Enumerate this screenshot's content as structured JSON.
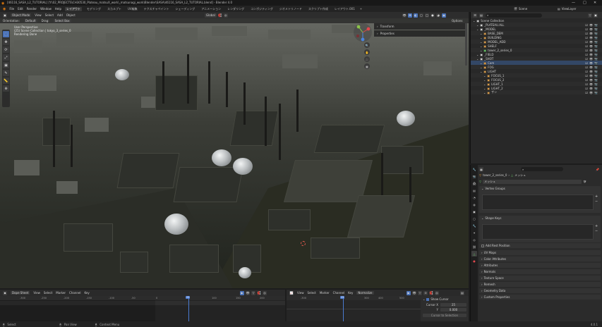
{
  "window": {
    "title": "[46116_SASA_L2_TUTORIAL] [Y:\\02_PROJECTS\\CH30530_Plateau_matsuX_work\\_matsunagi_work\\Blender\\SASA\\46116_SASA_L2_TUTORIAL.blend] - Blender 4.0",
    "minimize": "—",
    "maximize": "□",
    "close": "✕"
  },
  "menubar": {
    "menus": [
      "File",
      "Edit",
      "Render",
      "Window",
      "Help"
    ],
    "workspaces": [
      "レイアウト",
      "モデリング",
      "スカルプト",
      "UV編集",
      "テクスチャペイント",
      "シェーディング",
      "アニメーション",
      "レンダリング",
      "コンポジティング",
      "ジオメトリノード",
      "スクリプト作成",
      "レイアウト.001"
    ],
    "active_workspace": "レイアウト",
    "scene_label": "Scene",
    "viewlayer_label": "ViewLayer"
  },
  "viewport": {
    "mode": "Object Mode",
    "menus": [
      "View",
      "Select",
      "Add",
      "Object"
    ],
    "orientation_label": "Orientation:",
    "orientation_value": "Default",
    "drag_label": "Drag:",
    "drag_value": "Select Box",
    "transform_pivot": "Global",
    "options_label": "Options",
    "info_lines": [
      "User Perspective",
      "(25) Scene Collection | tokyo_3_series_0",
      "Rendering Done"
    ],
    "npanel": [
      "Transform",
      "Properties"
    ]
  },
  "toolbar": [
    "⬚",
    "✥",
    "⟳",
    "⤢",
    "▣",
    "✎",
    "📏",
    "⊕"
  ],
  "outliner": {
    "search_placeholder": "",
    "rows": [
      {
        "label": "Scene Collection",
        "indent": 0,
        "sel": false
      },
      {
        "label": "_PLATEAU.ALL",
        "indent": 1,
        "sel": false
      },
      {
        "label": "_MODEL",
        "indent": 1,
        "sel": false
      },
      {
        "label": "BASE_DEM",
        "indent": 2,
        "sel": false
      },
      {
        "label": "BUILDING",
        "indent": 2,
        "sel": false
      },
      {
        "label": "MODEL_ADD",
        "indent": 2,
        "sel": false
      },
      {
        "label": "SHELF",
        "indent": 2,
        "sel": false
      },
      {
        "label": "tower_2_series_0",
        "indent": 2,
        "sel": false
      },
      {
        "label": "_FIELD",
        "indent": 1,
        "sel": false
      },
      {
        "label": "_SHOT",
        "indent": 1,
        "sel": false
      },
      {
        "label": "Cam",
        "indent": 2,
        "sel": true
      },
      {
        "label": "FOG",
        "indent": 2,
        "sel": false
      },
      {
        "label": "LIGHT",
        "indent": 2,
        "sel": false
      },
      {
        "label": "FOCUS_1",
        "indent": 3,
        "sel": false
      },
      {
        "label": "FOCUS_2",
        "indent": 3,
        "sel": false
      },
      {
        "label": "LIGHT_1",
        "indent": 3,
        "sel": false
      },
      {
        "label": "LIGHT_2",
        "indent": 3,
        "sel": false
      },
      {
        "label": "ザン",
        "indent": 3,
        "sel": false
      }
    ]
  },
  "properties": {
    "object_name": "tower_2_series_0",
    "mesh_label": "メッシュ",
    "data_name": "メッシュ",
    "sections": [
      {
        "label": "Vertex Groups",
        "open": true
      },
      {
        "label": "Shape Keys",
        "open": true
      },
      {
        "label": "Add Rest Position",
        "open": false
      },
      {
        "label": "UV Maps",
        "open": false
      },
      {
        "label": "Color Attributes",
        "open": false
      },
      {
        "label": "Attributes",
        "open": false
      },
      {
        "label": "Normals",
        "open": false
      },
      {
        "label": "Texture Space",
        "open": false
      },
      {
        "label": "Remesh",
        "open": false
      },
      {
        "label": "Geometry Data",
        "open": false
      },
      {
        "label": "Custom Properties",
        "open": false
      }
    ]
  },
  "timeline": {
    "menus": [
      "Dope Sheet",
      "View",
      "Select",
      "Marker",
      "Channel",
      "Key"
    ],
    "ruler": [
      "-300",
      "-250",
      "-200",
      "-150",
      "-100",
      "-50",
      "0",
      "50",
      "100",
      "150",
      "200",
      "250",
      "300"
    ],
    "current_frame": "25"
  },
  "graph": {
    "menus": [
      "View",
      "Select",
      "Marker",
      "Channel",
      "Key"
    ],
    "normalize_label": "Normalize",
    "ruler": [
      "-300",
      "0",
      "300",
      "400",
      "500"
    ],
    "current_frame": "25",
    "panel": {
      "show_cursor_label": "Show Cursor",
      "cursor_x_label": "Cursor X",
      "cursor_x_value": "25",
      "cursor_y_label": "Y",
      "cursor_y_value": "0.000",
      "cursor_to_selection": "Cursor to Selection"
    }
  },
  "statusbar": {
    "items": [
      "Select",
      "Pan View",
      "Context Menu"
    ],
    "version": "4.0.1"
  },
  "colors": {
    "accent": "#4a72b8",
    "selection": "#334766"
  }
}
